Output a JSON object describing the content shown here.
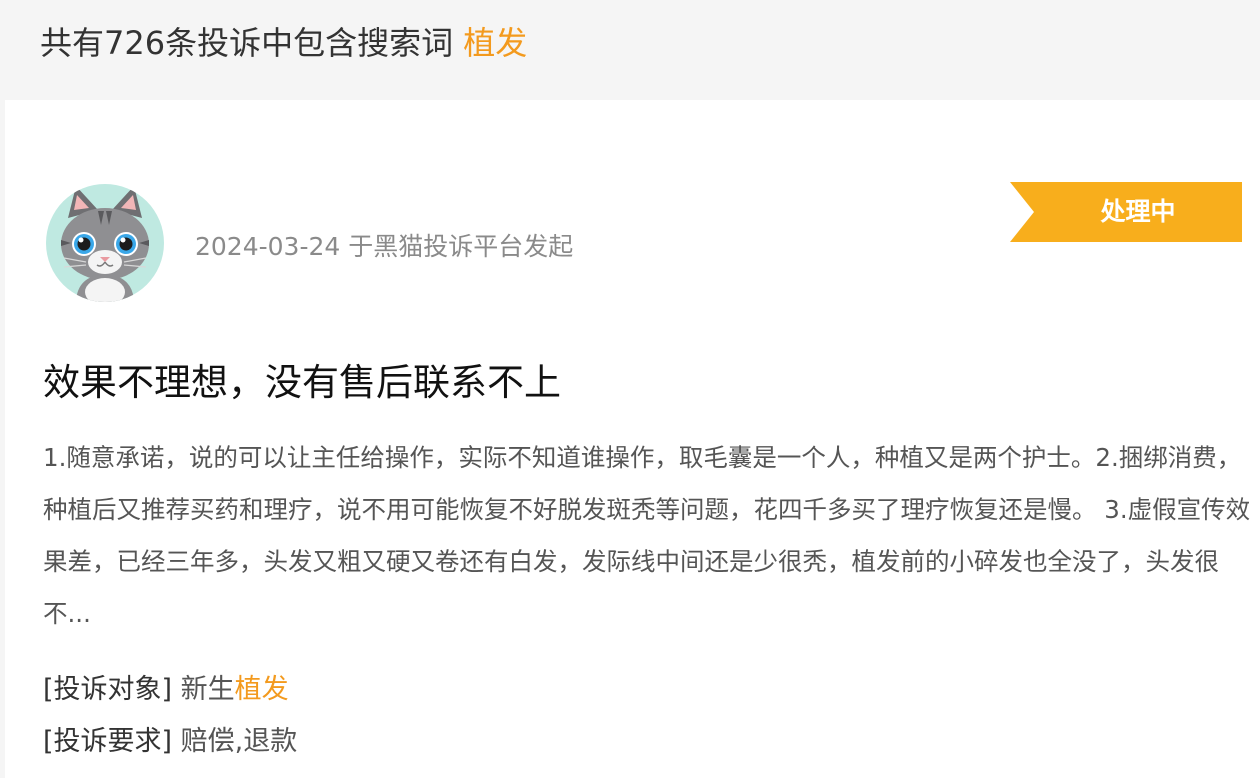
{
  "header": {
    "prefix": "共有726条投诉中包含搜索词",
    "keyword": "植发"
  },
  "complaint": {
    "date": "2024-03-24",
    "source_text": "于黑猫投诉平台发起",
    "status": "处理中",
    "title": "效果不理想，没有售后联系不上",
    "content": "1.随意承诺，说的可以让主任给操作，实际不知道谁操作，取毛囊是一个人，种植又是两个护士。2.捆绑消费，种植后又推荐买药和理疗，说不用可能恢复不好脱发斑秃等问题，花四千多买了理疗恢复还是慢。 3.虚假宣传效果差，已经三年多，头发又粗又硬又卷还有白发，发际线中间还是少很秃，植发前的小碎发也全没了，头发很不...",
    "target_label": "[投诉对象]",
    "target_value_plain": "新生",
    "target_value_highlight": "植发",
    "request_label": "[投诉要求]",
    "request_value": "赔偿,退款"
  },
  "colors": {
    "accent": "#f39a1e",
    "status_bg": "#f8ae1c",
    "avatar_bg": "#bfe9e1"
  },
  "icons": {
    "avatar": "cat-avatar-icon",
    "status": "ribbon-tag-icon"
  }
}
